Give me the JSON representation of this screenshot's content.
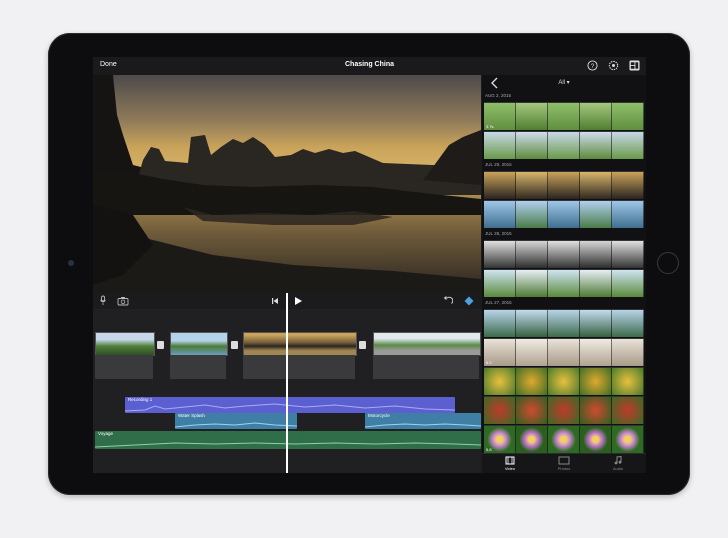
{
  "app": {
    "done_label": "Done",
    "project_title": "Chasing China"
  },
  "browser": {
    "filter_label": "All",
    "groups": [
      {
        "date": "AUG 2, 2015",
        "clips": [
          {
            "duration": "3.7s",
            "theme": "field"
          },
          {
            "duration": "",
            "theme": "field2"
          }
        ]
      },
      {
        "date": "JUL 29, 2015",
        "clips": [
          {
            "duration": "",
            "theme": "sunset"
          },
          {
            "duration": "",
            "theme": "river"
          }
        ]
      },
      {
        "date": "JUL 28, 2015",
        "clips": [
          {
            "duration": "",
            "theme": "bw"
          },
          {
            "duration": "",
            "theme": "mountain"
          }
        ]
      },
      {
        "date": "JUL 27, 2015",
        "clips": [
          {
            "duration": "",
            "theme": "lake"
          },
          {
            "duration": "6.0",
            "theme": "stone"
          },
          {
            "duration": "",
            "theme": "food"
          },
          {
            "duration": "",
            "theme": "greens"
          },
          {
            "duration": "5.8",
            "theme": "flower"
          }
        ]
      }
    ],
    "tabs": [
      {
        "label": "Video",
        "icon": "film-icon"
      },
      {
        "label": "Photos",
        "icon": "photos-icon"
      },
      {
        "label": "Audio",
        "icon": "music-note-icon"
      }
    ]
  },
  "timeline": {
    "audio_tracks": [
      {
        "label": "Recording 1",
        "color": "#5b5fd0"
      },
      {
        "label": "Water Splash",
        "color": "#3f7fa6"
      },
      {
        "label": "Motorcycle",
        "color": "#3f7fa6"
      },
      {
        "label": "Voyage",
        "color": "#2f6e49"
      }
    ]
  },
  "colors": {
    "accent": "#4aa3e0",
    "background": "#1c1c1e"
  }
}
